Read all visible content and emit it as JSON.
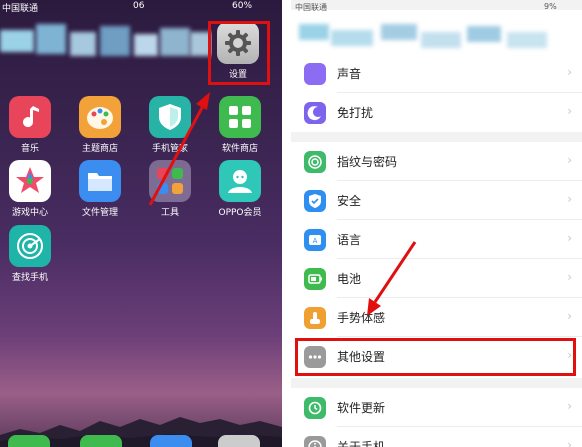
{
  "left_screen": {
    "status": {
      "carrier": "中国联通",
      "time": "06",
      "battery": "60%"
    },
    "apps": [
      {
        "id": "music",
        "label": "音乐",
        "color": "#e8445a",
        "icon": "music-note-icon"
      },
      {
        "id": "theme-store",
        "label": "主题商店",
        "color": "#f3a23a",
        "icon": "palette-icon"
      },
      {
        "id": "phone-manager",
        "label": "手机管家",
        "color": "#27b3a5",
        "icon": "shield-icon"
      },
      {
        "id": "software-store",
        "label": "软件商店",
        "color": "#3fba4f",
        "icon": "grid-icon"
      },
      {
        "id": "game-center",
        "label": "游戏中心",
        "color": "#ffffff",
        "icon": "star-icon"
      },
      {
        "id": "file-manager",
        "label": "文件管理",
        "color": "#3b8df0",
        "icon": "folder-icon"
      },
      {
        "id": "tools",
        "label": "工具",
        "color": "#8a7fa8",
        "icon": "folder-grid-icon"
      },
      {
        "id": "oppo-member",
        "label": "OPPO会员",
        "color": "#2fc7b8",
        "icon": "person-icon"
      },
      {
        "id": "find-phone",
        "label": "查找手机",
        "color": "#1fb4a8",
        "icon": "radar-icon"
      }
    ],
    "settings_app": {
      "label": "设置",
      "icon": "gear-icon"
    }
  },
  "right_screen": {
    "status": {
      "carrier": "中国联通",
      "battery": "9%"
    },
    "group1": [
      {
        "label": "声音",
        "color": "#8b6cf3",
        "icon": "sound-icon"
      },
      {
        "label": "免打扰",
        "color": "#7e63ec",
        "icon": "moon-icon"
      }
    ],
    "group2": [
      {
        "label": "指纹与密码",
        "color": "#3fba6a",
        "icon": "fingerprint-icon"
      },
      {
        "label": "安全",
        "color": "#2f8ff0",
        "icon": "shield-check-icon"
      },
      {
        "label": "语言",
        "color": "#2f8ff0",
        "icon": "language-icon"
      },
      {
        "label": "电池",
        "color": "#3fba4f",
        "icon": "battery-icon"
      },
      {
        "label": "手势体感",
        "color": "#f0a030",
        "icon": "gesture-icon"
      },
      {
        "label": "其他设置",
        "color": "#9a9a9a",
        "icon": "more-icon"
      }
    ],
    "group3": [
      {
        "label": "软件更新",
        "color": "#3fba6a",
        "icon": "update-icon"
      },
      {
        "label": "关于手机",
        "color": "#9a9a9a",
        "icon": "info-icon"
      }
    ],
    "chevron": "›"
  },
  "colors": {
    "highlight_red": "#e01010"
  }
}
